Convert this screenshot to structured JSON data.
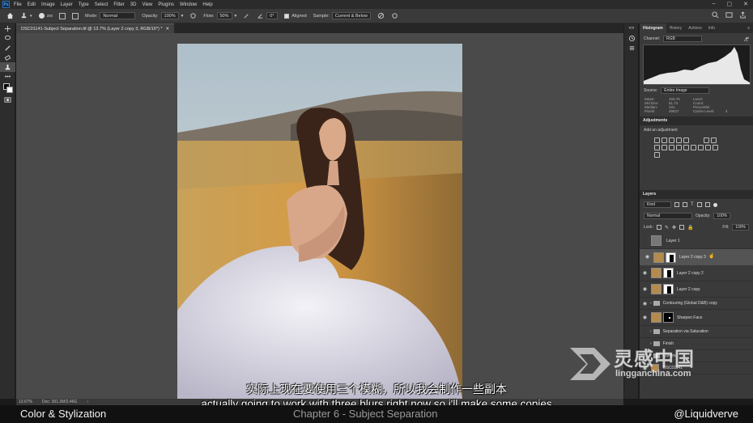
{
  "app": {
    "logo": "Ps"
  },
  "menu": [
    "File",
    "Edit",
    "Image",
    "Layer",
    "Type",
    "Select",
    "Filter",
    "3D",
    "View",
    "Plugins",
    "Window",
    "Help"
  ],
  "options": {
    "brush_size": "200",
    "mode_label": "Mode:",
    "mode_value": "Normal",
    "opacity_label": "Opacity:",
    "opacity_value": "100%",
    "flow_label": "Flow:",
    "flow_value": "50%",
    "angle_value": "0°",
    "aligned_label": "Aligned",
    "sample_label": "Sample:",
    "sample_value": "Current & Below"
  },
  "document": {
    "tab_title": "DSC01141-Subject Separation.tif @ 13.7% (Layer 2 copy 3, RGB/16*) *",
    "zoom": "13.67%",
    "doc_size": "Doc: 391.2M/2.46G"
  },
  "histogram": {
    "tabs": [
      "Histogram",
      "History",
      "Actions",
      "Info"
    ],
    "channel_label": "Channel:",
    "channel_value": "RGB",
    "source_label": "Source:",
    "source_value": "Entire Image",
    "stats": [
      [
        "Mean:",
        "103.75",
        "Level:",
        ""
      ],
      [
        "Std Dev:",
        "51.72",
        "Count:",
        ""
      ],
      [
        "Median:",
        "101",
        "Percentile:",
        ""
      ],
      [
        "Pixels:",
        "49627",
        "Cache Level:",
        "4"
      ]
    ]
  },
  "adjustments": {
    "title": "Adjustments",
    "hint": "Add an adjustment"
  },
  "layers": {
    "title": "Layers",
    "filter_value": "Kind",
    "blend_value": "Normal",
    "opacity_label": "Opacity:",
    "opacity_value": "100%",
    "lock_label": "Lock:",
    "fill_label": "Fill:",
    "fill_value": "100%",
    "items": [
      {
        "name": "Layer 1",
        "type": "layer"
      },
      {
        "name": "Layer 2 copy 3",
        "type": "masked"
      },
      {
        "name": "Layer 2 copy 2",
        "type": "masked"
      },
      {
        "name": "Layer 2 copy",
        "type": "masked"
      },
      {
        "name": "Contouring (Global D&B) copy",
        "type": "group"
      },
      {
        "name": "Sharpen Face",
        "type": "masked"
      },
      {
        "name": "Separation via Saturation",
        "type": "group"
      },
      {
        "name": "Finish",
        "type": "group"
      },
      {
        "name": "Curves",
        "type": "group"
      },
      {
        "name": "DSC01141",
        "type": "layer"
      }
    ]
  },
  "subtitles": {
    "cn": "实际上现在要使用三个模糊，所以我会制作一些副本",
    "en": "actually going to work with three blurs right now so i'll make some copies"
  },
  "bottom_bar": {
    "left": "Color & Stylization",
    "middle": "Chapter 6 - Subject Separation",
    "right": "@Liquidverve"
  },
  "watermark": {
    "text": "灵感中国",
    "url": "lingganchina.com"
  }
}
